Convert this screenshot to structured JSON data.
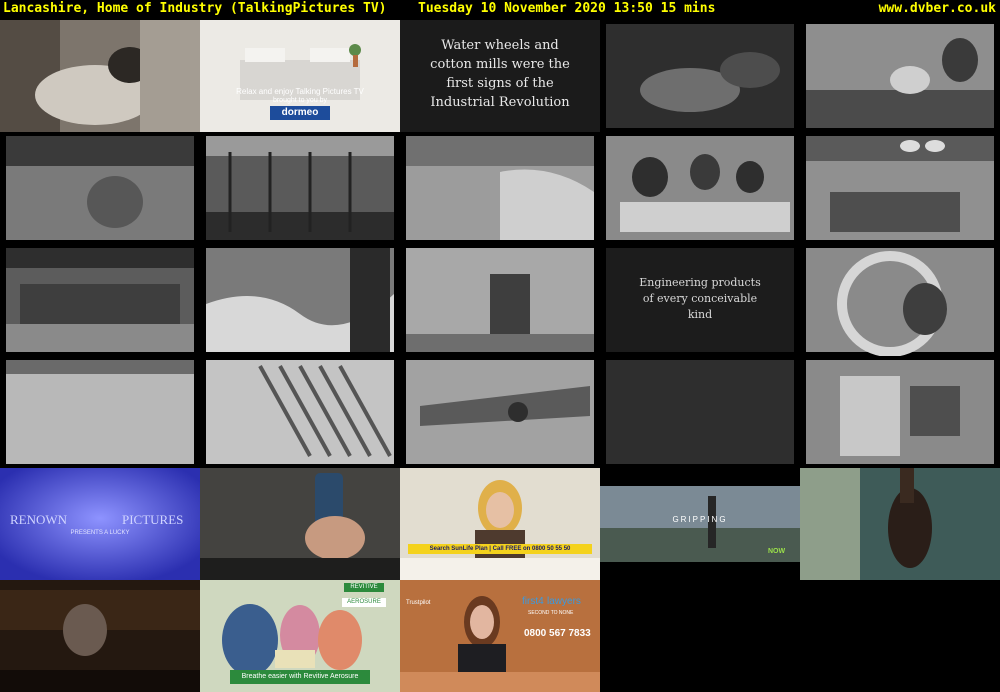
{
  "header": {
    "title": "Lancashire, Home of Industry (TalkingPictures TV)",
    "airtime": "Tuesday 10 November 2020  13:50  15 mins",
    "site": "www.dvber.co.uk"
  },
  "captions": {
    "water_wheels": [
      "Water wheels and",
      "cotton mills were the",
      "first signs of the",
      "Industrial Revolution"
    ],
    "engineering": [
      "Engineering products",
      "of every conceivable",
      "kind"
    ],
    "dormeo_line1": "Relax and enjoy Talking Pictures TV",
    "dormeo_line2": "brought to you by",
    "dormeo_brand": "dormeo",
    "renown_left": "RENOWN",
    "renown_right": "PICTURES",
    "renown_sub": "PRESENTS A LUCKY",
    "sunlife_search": "Search SunLife Plan | Call FREE on 0800 50 55 50",
    "gripping": "GRIPPING",
    "nowtv": "NOW",
    "revitive_brand": "REVITIVE",
    "revitive_product": "AEROSURE",
    "revitive_banner": "Breathe easier with Revitive Aerosure",
    "trustpilot": "Trustpilot",
    "first4lawyers_a": "first4",
    "first4lawyers_b": "lawyers",
    "first4lawyers_tag": "SECOND TO NONE",
    "first4lawyers_phone": "0800 567 7833"
  },
  "colors": {
    "header_text": "#ffff00",
    "background": "#000000"
  }
}
